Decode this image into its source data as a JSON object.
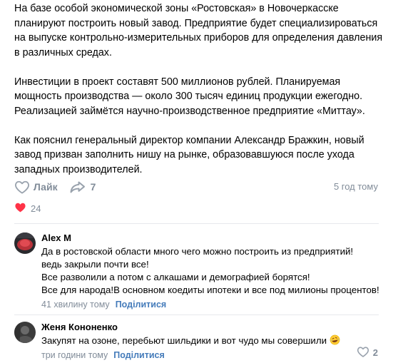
{
  "post": {
    "paragraphs": [
      [
        "На базе особой экономической зоны «Ростовская» в Новочеркасске",
        "планируют построить новый завод. Предприятие будет специализироваться",
        "на выпуске контрольно-измерительных приборов для определения давления",
        "в различных средах."
      ],
      [
        "Инвестиции в проект составят 500 миллионов рублей. Планируемая",
        "мощность производства — около 300 тысяч единиц продукции ежегодно.",
        "Реализацией займётся научно-производственное предприятие «Миттау»."
      ],
      [
        "Как пояснил генеральный директор компании Александр Бражкин, новый",
        "завод призван заполнить нишу на рынке, образовавшуюся после ухода",
        "западных производителей."
      ]
    ],
    "like_label": "Лайк",
    "share_count": "7",
    "time": "5 год тому",
    "reaction_count": "24",
    "colors": {
      "accent": "#447bba",
      "muted": "#818c99",
      "heart": "#ff3347"
    }
  },
  "comments": [
    {
      "author": "Alex M",
      "lines": [
        "Да в ростовской области много чего можно построить из предприятий!",
        "ведь закрыли почти все!",
        "Все разволили а потом с алкашами и демографией борятся!",
        "Все для народа!В основном коедиты ипотеки и все под милионы процентов!"
      ],
      "time": "41 хвилину тому",
      "reply_label": "Поділитися"
    },
    {
      "author": "Женя Кононенко",
      "lines": [
        "Закупят на озоне, перебьют шильдики и вот чудо мы совершили"
      ],
      "emoji": "rolling-on-floor-laughing-emoji",
      "time": "три години тому",
      "reply_label": "Поділитися",
      "like_count": "2"
    }
  ]
}
